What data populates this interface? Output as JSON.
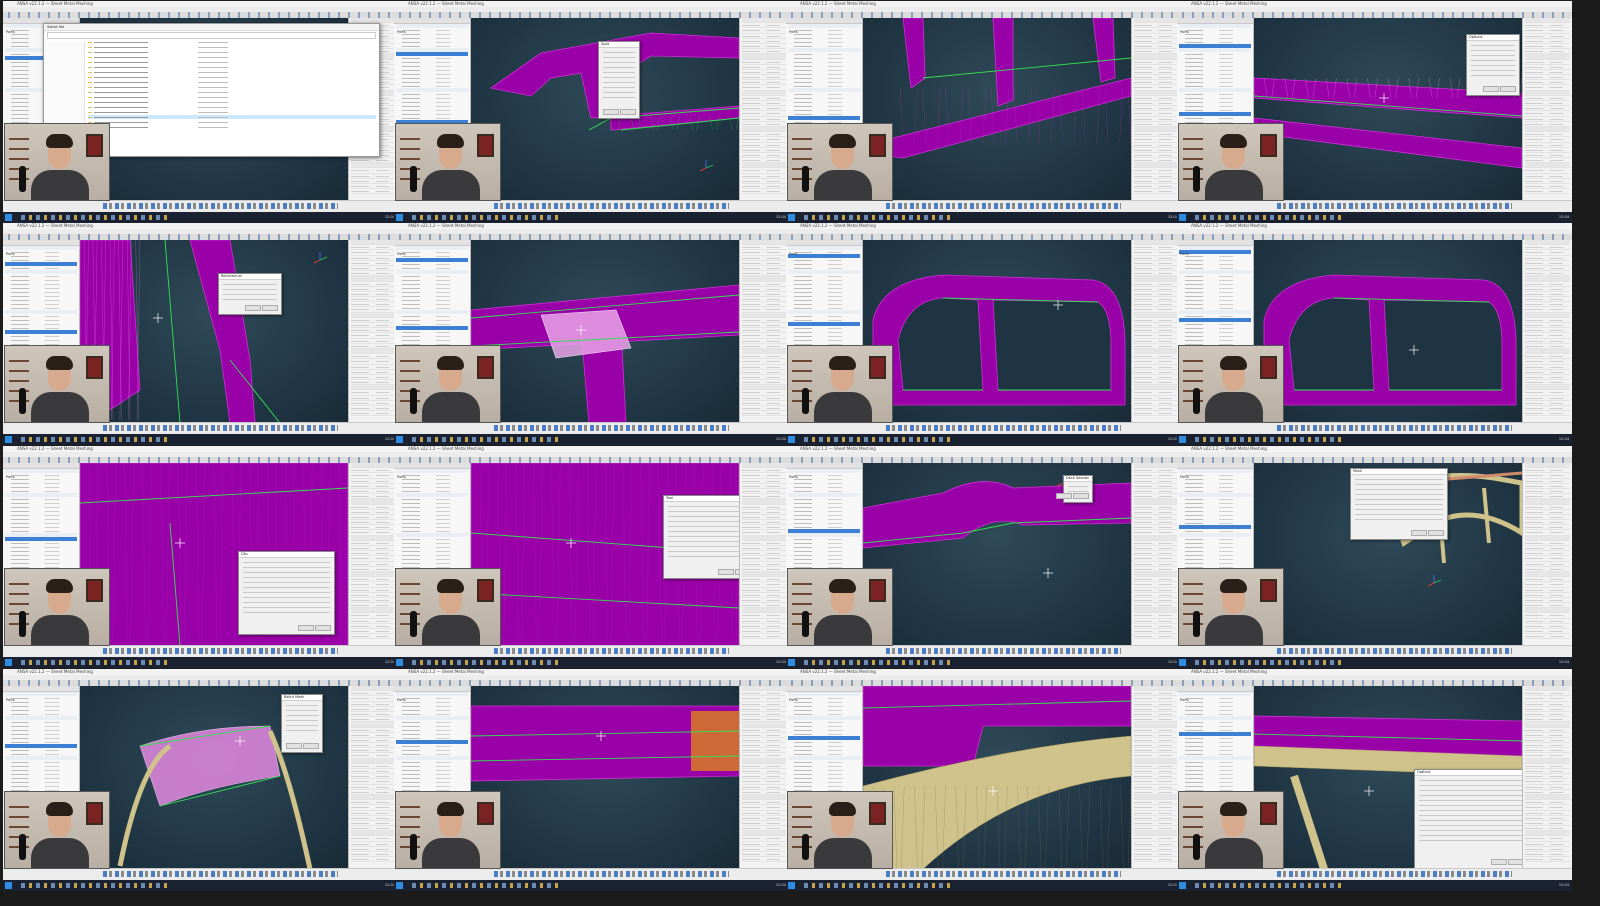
{
  "window": {
    "title_bar_text": "ANSA v22.1.2 — Sheet Metal Meshing",
    "menu_items": [
      "File",
      "Tools",
      "Utilities",
      "View",
      "Assembly",
      "Mesh",
      "Analysis Tools",
      "Plugins",
      "Windows",
      "Help"
    ],
    "browser_header": "Parts",
    "taskbar_clock": "12:04"
  },
  "explorer": {
    "title": "Select file"
  },
  "dialogs": {
    "spot": "Spot",
    "pop": "Options",
    "reconstruct": "Reconstruct",
    "clip": "Clip",
    "tool": "Tool",
    "deck": "Deck Session",
    "mesh": "Mesh",
    "batch": "Batch Mesh",
    "options": "Options",
    "output": "Output"
  },
  "colors": {
    "viewport_bg": "#1f3443",
    "mesh_magenta": "#9a00a8",
    "mesh_edge": "#d12ed8",
    "feature_line": "#34e04f",
    "tan_mesh": "#cfc28a",
    "orange_part": "#d4742a",
    "selection_pink": "#e8a4e8"
  },
  "icons": [
    "cursor-crosshair-icon",
    "axis-triad-icon",
    "windows-start-icon"
  ]
}
